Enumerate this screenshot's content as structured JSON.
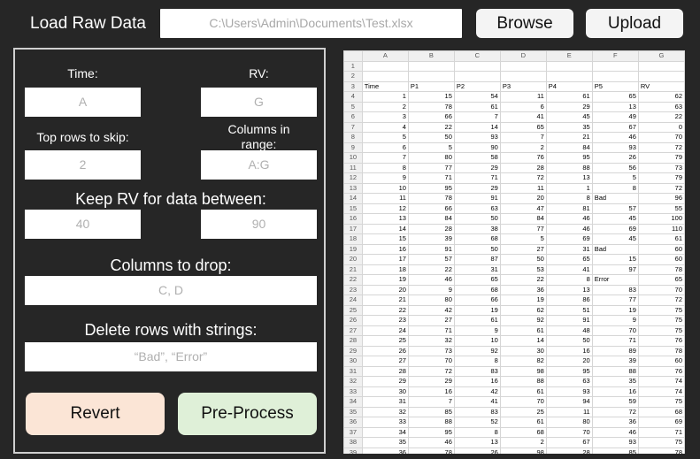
{
  "header": {
    "load_label": "Load Raw Data",
    "file_path": "C:\\Users\\Admin\\Documents\\Test.xlsx",
    "browse_label": "Browse",
    "upload_label": "Upload"
  },
  "panel": {
    "time_label": "Time:",
    "time_value": "A",
    "rv_label": "RV:",
    "rv_value": "G",
    "skip_label": "Top rows to skip:",
    "skip_value": "2",
    "range_label": "Columns in range:",
    "range_value": "A:G",
    "keep_label": "Keep RV for data between:",
    "keep_min": "40",
    "keep_max": "90",
    "drop_label": "Columns to drop:",
    "drop_value": "C, D",
    "delete_label": "Delete rows with strings:",
    "delete_value": "“Bad”, “Error”",
    "revert_label": "Revert",
    "preprocess_label": "Pre-Process"
  },
  "sheet": {
    "col_letters": [
      "A",
      "B",
      "C",
      "D",
      "E",
      "F",
      "G"
    ],
    "rows": [
      [
        "",
        "",
        "",
        "",
        "",
        "",
        ""
      ],
      [
        "",
        "",
        "",
        "",
        "",
        "",
        ""
      ],
      [
        "Time",
        "P1",
        "P2",
        "P3",
        "P4",
        "P5",
        "RV"
      ],
      [
        "1",
        "15",
        "54",
        "11",
        "61",
        "65",
        "62"
      ],
      [
        "2",
        "78",
        "61",
        "6",
        "29",
        "13",
        "63"
      ],
      [
        "3",
        "66",
        "7",
        "41",
        "45",
        "49",
        "22"
      ],
      [
        "4",
        "22",
        "14",
        "65",
        "35",
        "67",
        "0"
      ],
      [
        "5",
        "50",
        "93",
        "7",
        "21",
        "46",
        "70"
      ],
      [
        "6",
        "5",
        "90",
        "2",
        "84",
        "93",
        "72"
      ],
      [
        "7",
        "80",
        "58",
        "76",
        "95",
        "26",
        "79"
      ],
      [
        "8",
        "77",
        "29",
        "28",
        "88",
        "56",
        "73"
      ],
      [
        "9",
        "71",
        "71",
        "72",
        "13",
        "5",
        "79"
      ],
      [
        "10",
        "95",
        "29",
        "11",
        "1",
        "8",
        "72"
      ],
      [
        "11",
        "78",
        "91",
        "20",
        "8",
        "Bad",
        "96"
      ],
      [
        "12",
        "66",
        "63",
        "47",
        "81",
        "57",
        "55"
      ],
      [
        "13",
        "84",
        "50",
        "84",
        "46",
        "45",
        "100"
      ],
      [
        "14",
        "28",
        "38",
        "77",
        "46",
        "69",
        "110"
      ],
      [
        "15",
        "39",
        "68",
        "5",
        "69",
        "45",
        "61"
      ],
      [
        "16",
        "91",
        "50",
        "27",
        "31",
        "Bad",
        "60"
      ],
      [
        "17",
        "57",
        "87",
        "50",
        "65",
        "15",
        "60"
      ],
      [
        "18",
        "22",
        "31",
        "53",
        "41",
        "97",
        "78"
      ],
      [
        "19",
        "46",
        "65",
        "22",
        "8",
        "Error",
        "65"
      ],
      [
        "20",
        "9",
        "68",
        "36",
        "13",
        "83",
        "70"
      ],
      [
        "21",
        "80",
        "66",
        "19",
        "86",
        "77",
        "72"
      ],
      [
        "22",
        "42",
        "19",
        "62",
        "51",
        "19",
        "75"
      ],
      [
        "23",
        "27",
        "61",
        "92",
        "91",
        "9",
        "75"
      ],
      [
        "24",
        "71",
        "9",
        "61",
        "48",
        "70",
        "75"
      ],
      [
        "25",
        "32",
        "10",
        "14",
        "50",
        "71",
        "76"
      ],
      [
        "26",
        "73",
        "92",
        "30",
        "16",
        "89",
        "78"
      ],
      [
        "27",
        "70",
        "8",
        "82",
        "20",
        "39",
        "60"
      ],
      [
        "28",
        "72",
        "83",
        "98",
        "95",
        "88",
        "76"
      ],
      [
        "29",
        "29",
        "16",
        "88",
        "63",
        "35",
        "74"
      ],
      [
        "30",
        "16",
        "42",
        "61",
        "93",
        "16",
        "74"
      ],
      [
        "31",
        "7",
        "41",
        "70",
        "94",
        "59",
        "75"
      ],
      [
        "32",
        "85",
        "83",
        "25",
        "11",
        "72",
        "68"
      ],
      [
        "33",
        "88",
        "52",
        "61",
        "80",
        "36",
        "69"
      ],
      [
        "34",
        "95",
        "8",
        "68",
        "70",
        "46",
        "71"
      ],
      [
        "35",
        "46",
        "13",
        "2",
        "67",
        "93",
        "75"
      ],
      [
        "36",
        "78",
        "26",
        "98",
        "28",
        "85",
        "78"
      ]
    ]
  }
}
